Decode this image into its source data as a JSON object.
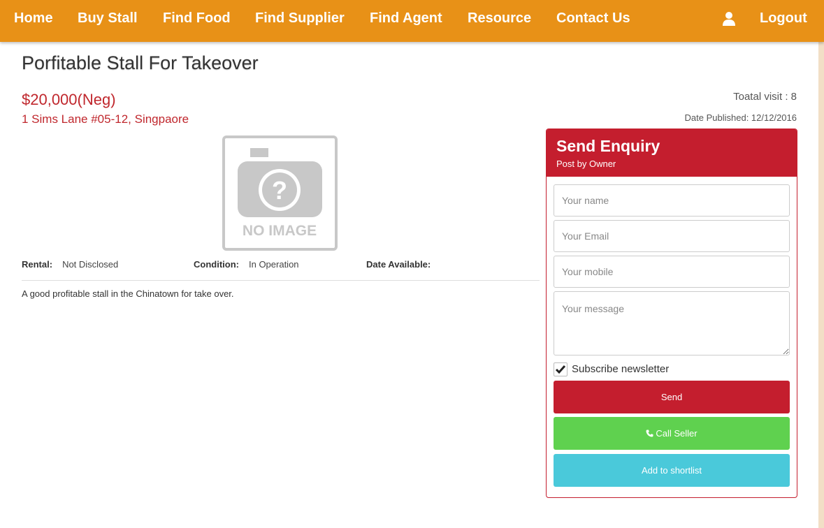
{
  "nav": {
    "items": [
      {
        "label": "Home"
      },
      {
        "label": "Buy Stall"
      },
      {
        "label": "Find Food"
      },
      {
        "label": "Find Supplier"
      },
      {
        "label": "Find Agent"
      },
      {
        "label": "Resource"
      },
      {
        "label": "Contact Us"
      }
    ],
    "user_icon": "user-icon",
    "logout": "Logout"
  },
  "listing": {
    "title": "Porfitable Stall For Takeover",
    "price": "$20,000(Neg)",
    "address": "1 Sims Lane #05-12, Singpaore",
    "visits": "Toatal visit : 8",
    "published": "Date Published: 12/12/2016",
    "image_placeholder": "NO IMAGE",
    "rental_label": "Rental:",
    "rental_value": "Not Disclosed",
    "condition_label": "Condition:",
    "condition_value": "In Operation",
    "date_available_label": "Date Available:",
    "date_available_value": "",
    "description": "A good profitable stall in the Chinatown for take over."
  },
  "enquiry": {
    "title": "Send Enquiry",
    "subtitle": "Post by Owner",
    "name_placeholder": "Your name",
    "email_placeholder": "Your Email",
    "mobile_placeholder": "Your mobile",
    "message_placeholder": "Your message",
    "subscribe_label": "Subscribe newsletter",
    "subscribe_checked": true,
    "send_label": "Send",
    "call_label": "Call Seller",
    "shortlist_label": "Add to shortlist"
  },
  "colors": {
    "navbar": "#e89117",
    "accent_red": "#c41e2e",
    "call_green": "#5fd14f",
    "shortlist_cyan": "#4ac9da",
    "background": "#f2dfc6"
  }
}
